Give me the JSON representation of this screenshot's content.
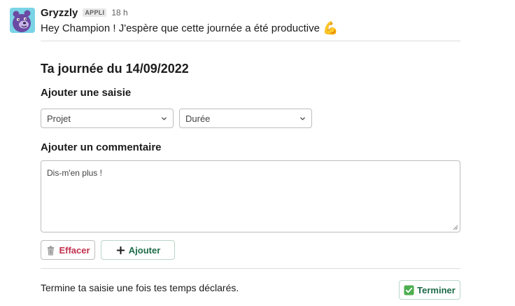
{
  "message": {
    "sender": "Gryzzly",
    "badge": "APPLI",
    "timestamp": "18 h",
    "greeting": "Hey Champion ! J'espère que cette journée a été productive",
    "greeting_emoji": "💪",
    "avatar_icon": "bear-mascot-icon"
  },
  "block": {
    "title": "Ta journée du 14/09/2022",
    "entry_label": "Ajouter une saisie",
    "project_select": {
      "value": "Projet",
      "icon": "chevron-down-icon"
    },
    "duration_select": {
      "value": "Durée",
      "icon": "chevron-down-icon"
    },
    "comment_label": "Ajouter un commentaire",
    "comment_placeholder": "Dis-m'en plus !",
    "clear_button": {
      "label": "Effacer",
      "icon": "wastebasket-icon"
    },
    "add_button": {
      "label": "Ajouter",
      "icon": "plus-icon"
    },
    "footer_text": "Termine ta saisie une fois tes temps déclarés.",
    "finish_button": {
      "label": "Terminer",
      "icon": "check-mark-icon"
    }
  },
  "colors": {
    "avatar_bg": "#7ad4e6",
    "bear": "#6b4aa3",
    "danger": "#c0304d",
    "success": "#1d6b4a",
    "check_green": "#4caf50"
  }
}
